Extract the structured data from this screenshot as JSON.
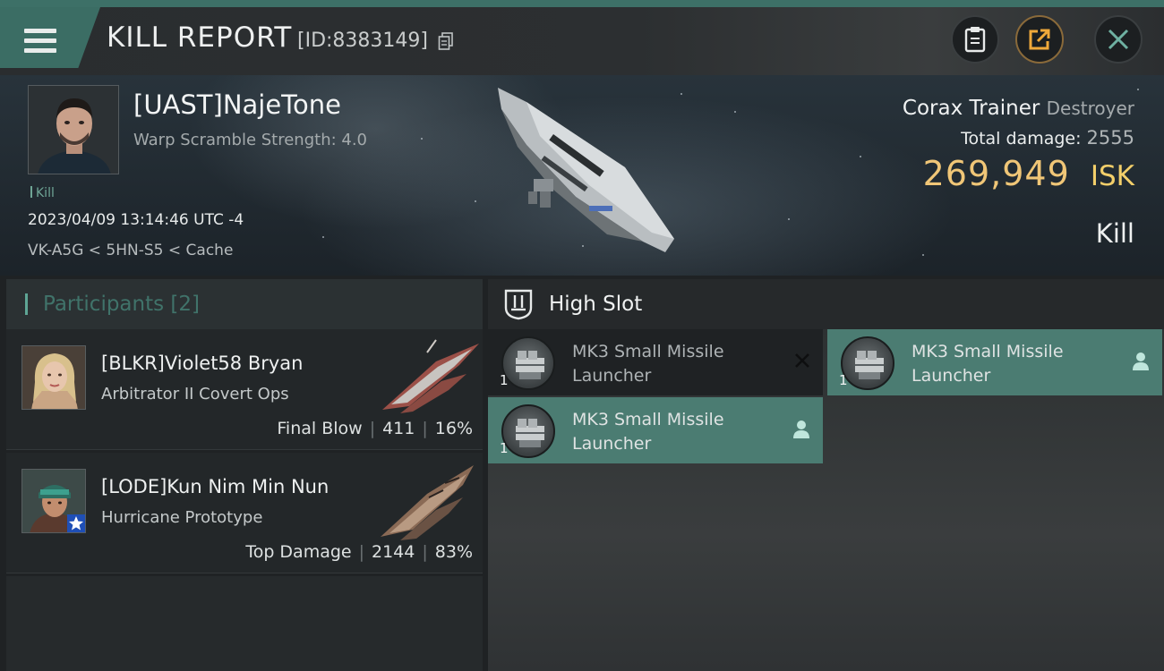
{
  "header": {
    "title": "KILL REPORT",
    "report_id": "[ID:8383149]",
    "icons": [
      "menu-icon",
      "copy-icon",
      "clipboard-icon",
      "export-icon",
      "close-icon"
    ]
  },
  "victim": {
    "name": "[UAST]NajeTone",
    "subtitle": "Warp Scramble Strength: 4.0",
    "tag": "Kill",
    "timestamp": "2023/04/09 13:14:46 UTC -4",
    "location": "VK-A5G < 5HN-S5 < Cache",
    "ship_name": "Corax Trainer",
    "ship_class": "Destroyer",
    "total_damage_label": "Total damage:",
    "total_damage": "2555",
    "isk_value": "269,949",
    "isk_unit": "ISK",
    "result": "Kill"
  },
  "participants": {
    "title": "Participants",
    "count": "[2]",
    "rows": [
      {
        "name": "[BLKR]Violet58 Bryan",
        "ship": "Arbitrator II Covert Ops",
        "role": "Final Blow",
        "damage": "411",
        "percent": "16%"
      },
      {
        "name": "[LODE]Kun Nim Min Nun",
        "ship": "Hurricane Prototype",
        "role": "Top Damage",
        "damage": "2144",
        "percent": "83%"
      }
    ]
  },
  "high_slot": {
    "title": "High Slot",
    "modules": [
      {
        "name": "MK3 Small Missile Launcher",
        "qty": "1",
        "state": "destroyed"
      },
      {
        "name": "MK3 Small Missile Launcher",
        "qty": "1",
        "state": "dropped"
      },
      {
        "name": "MK3 Small Missile Launcher",
        "qty": "1",
        "state": "dropped"
      }
    ]
  },
  "colors": {
    "accent_teal": "#4b7c72",
    "isk_gold": "#f0c677",
    "background": "#1f2224"
  }
}
